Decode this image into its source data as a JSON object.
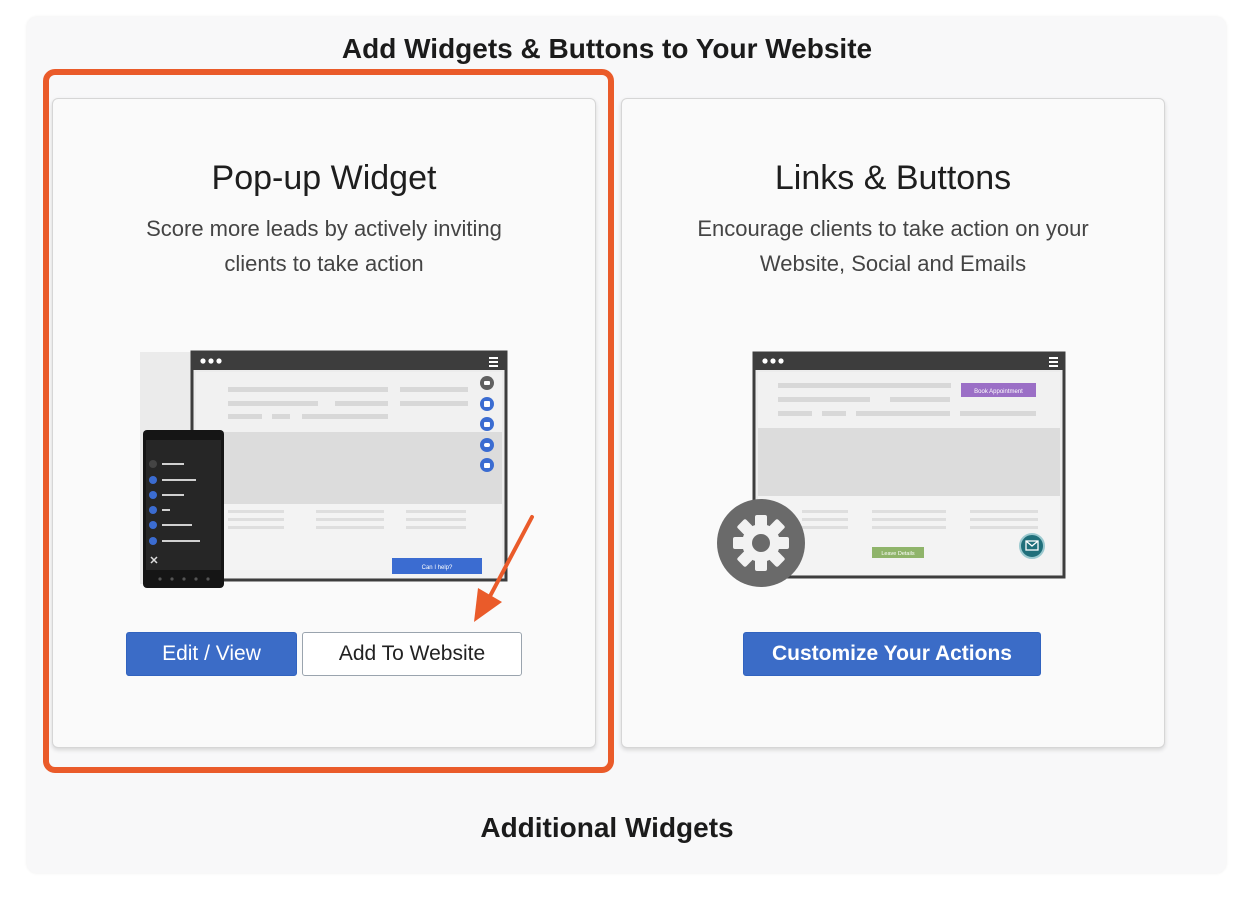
{
  "header": {
    "title": "Add Widgets & Buttons to Your Website"
  },
  "cards": [
    {
      "title": "Pop-up Widget",
      "description": "Score more leads by actively inviting clients to take action",
      "buttons": {
        "edit": "Edit / View",
        "add": "Add To Website"
      },
      "illustration": {
        "help_button": "Can I help?"
      }
    },
    {
      "title": "Links & Buttons",
      "description": "Encourage clients to take action on your Website, Social and Emails",
      "buttons": {
        "customize": "Customize Your Actions"
      },
      "illustration": {
        "book_button": "Book Appointment",
        "leave_button": "Leave Details"
      }
    }
  ],
  "footer": {
    "title": "Additional Widgets"
  },
  "colors": {
    "accent": "#3b6cc7",
    "highlight": "#ea5b2a",
    "green": "#8fb46a",
    "purple": "#9b6fc6"
  }
}
